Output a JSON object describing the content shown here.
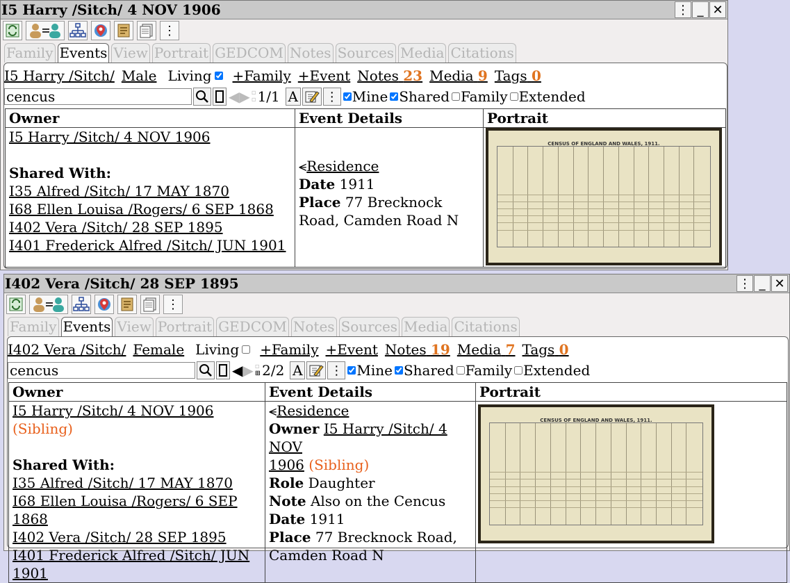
{
  "w1": {
    "title": "I5 Harry /Sitch/ 4 NOV 1906",
    "tabs": [
      "Family",
      "Events",
      "View",
      "Portrait",
      "GEDCOM",
      "Notes",
      "Sources",
      "Media",
      "Citations"
    ],
    "person_link": "I5 Harry /Sitch/",
    "sex": "Male",
    "living_label": "Living",
    "add_family": "+Family",
    "add_event": "+Event",
    "notes_label": "Notes",
    "notes_count": "23",
    "media_label": "Media",
    "media_count": "9",
    "tags_label": "Tags",
    "tags_count": "0",
    "search_value": "cencus",
    "pager": "1/1",
    "font_btn": "A",
    "filters": {
      "mine": "Mine",
      "shared": "Shared",
      "family": "Family",
      "extended": "Extended"
    },
    "table": {
      "headers": [
        "Owner",
        "Event Details",
        "Portrait"
      ],
      "owner": "I5 Harry /Sitch/ 4 NOV 1906",
      "shared_with_label": "Shared With:",
      "shared": [
        "I35 Alfred /Sitch/ 17 MAY 1870",
        "I68 Ellen Louisa /Rogers/ 6 SEP 1868",
        "I402 Vera /Sitch/ 28 SEP 1895",
        "I401 Frederick Alfred /Sitch/ JUN 1901"
      ],
      "event_type": "Residence",
      "date_label": "Date",
      "date_value": "1911",
      "place_label": "Place",
      "place_value": "77 Brecknock Road, Camden Road N"
    }
  },
  "w2": {
    "title": "I402 Vera /Sitch/ 28 SEP 1895",
    "tabs": [
      "Family",
      "Events",
      "View",
      "Portrait",
      "GEDCOM",
      "Notes",
      "Sources",
      "Media",
      "Citations"
    ],
    "person_link": "I402 Vera /Sitch/",
    "sex": "Female",
    "living_label": "Living",
    "add_family": "+Family",
    "add_event": "+Event",
    "notes_label": "Notes",
    "notes_count": "19",
    "media_label": "Media",
    "media_count": "7",
    "tags_label": "Tags",
    "tags_count": "0",
    "search_value": "cencus",
    "pager": "2/2",
    "font_btn": "A",
    "filters": {
      "mine": "Mine",
      "shared": "Shared",
      "family": "Family",
      "extended": "Extended"
    },
    "table": {
      "headers": [
        "Owner",
        "Event Details",
        "Portrait"
      ],
      "owner": "I5 Harry /Sitch/ 4 NOV 1906",
      "relation": "(Sibling)",
      "shared_with_label": "Shared With:",
      "shared": [
        "I35 Alfred /Sitch/ 17 MAY 1870",
        "I68 Ellen Louisa /Rogers/ 6 SEP 1868",
        "I402 Vera /Sitch/ 28 SEP 1895",
        "I401 Frederick Alfred /Sitch/ JUN 1901"
      ],
      "event_type": "Residence",
      "owner_label": "Owner",
      "owner_value_a": "I5 Harry /Sitch/ 4 NOV",
      "owner_value_b": "1906",
      "role_label": "Role",
      "role_value": "Daughter",
      "note_label": "Note",
      "note_value": "Also on the Cencus",
      "date_label": "Date",
      "date_value": "1911",
      "place_label": "Place",
      "place_value": "77 Brecknock Road, Camden Road N"
    }
  },
  "census_title": "CENSUS OF ENGLAND AND WALES, 1911."
}
